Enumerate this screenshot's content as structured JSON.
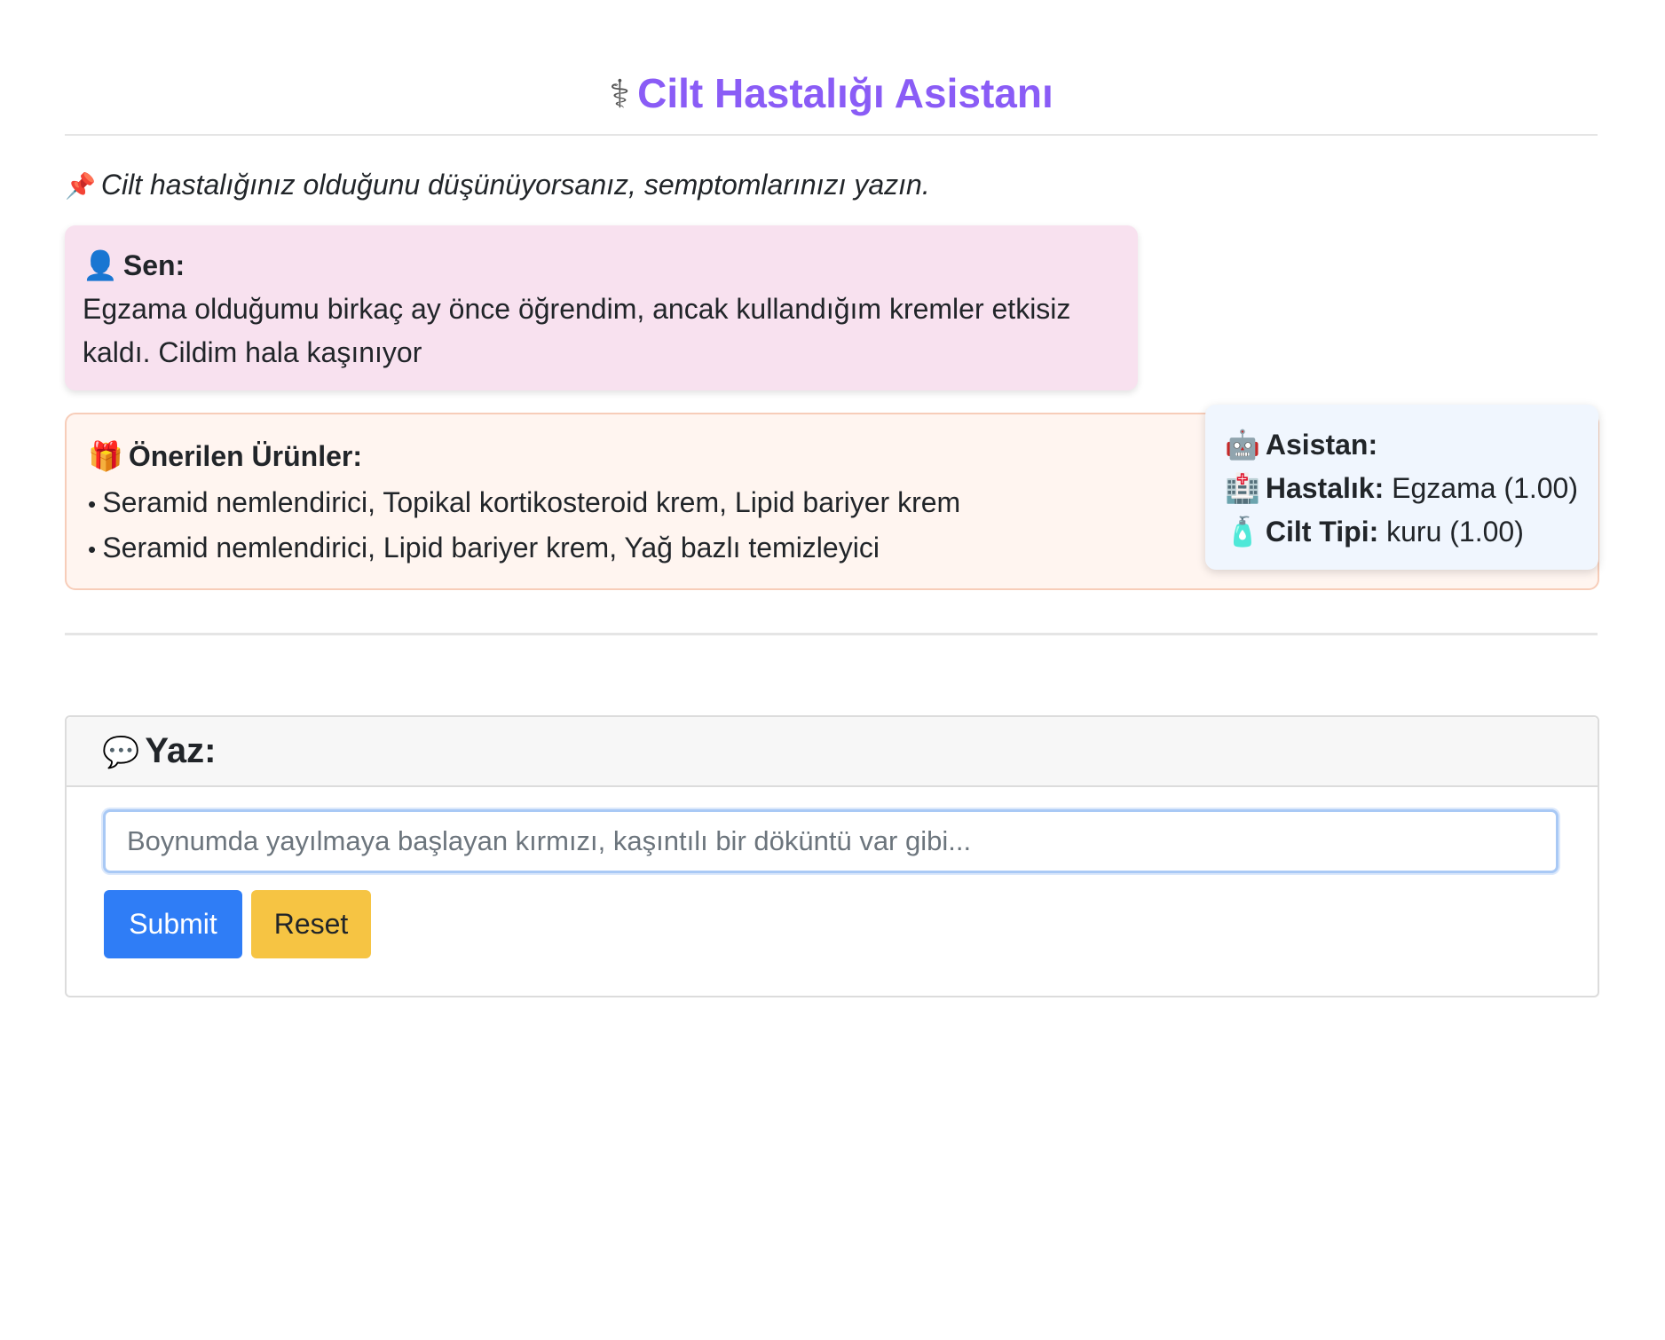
{
  "header": {
    "icon": "stethoscope-icon",
    "title": "Cilt Hastalığı Asistanı"
  },
  "hint": {
    "icon": "pushpin-icon",
    "text": "Cilt hastalığınız olduğunu düşünüyorsanız, semptomlarınızı yazın."
  },
  "user_message": {
    "icon": "user-silhouette-icon",
    "label": "Sen:",
    "text": "Egzama olduğumu birkaç ay önce öğrendim, ancak kullandığım kremler etkisiz kaldı. Cildim hala kaşınıyor"
  },
  "products": {
    "icon": "gift-icon",
    "label": "Önerilen Ürünler:",
    "items": [
      "Seramid nemlendirici, Topikal kortikosteroid krem, Lipid bariyer krem",
      "Seramid nemlendirici, Lipid bariyer krem, Yağ bazlı temizleyici"
    ]
  },
  "assistant": {
    "icon": "robot-icon",
    "label": "Asistan:",
    "disease": {
      "icon": "hospital-icon",
      "label": "Hastalık:",
      "value": "Egzama (1.00)"
    },
    "skin_type": {
      "icon": "lotion-bottle-icon",
      "label": "Cilt Tipi:",
      "value": "kuru (1.00)"
    }
  },
  "form": {
    "icon": "speech-bubble-icon",
    "label": "Yaz:",
    "input_placeholder": "Boynumda yayılmaya başlayan kırmızı, kaşıntılı bir döküntü var gibi...",
    "submit_label": "Submit",
    "reset_label": "Reset"
  },
  "colors": {
    "title": "#8a5cf6",
    "user_bg": "#f8e1ef",
    "products_bg": "#fff5f0",
    "assistant_bg": "#f0f6fe",
    "submit": "#2f7df6",
    "reset": "#f6c443"
  }
}
